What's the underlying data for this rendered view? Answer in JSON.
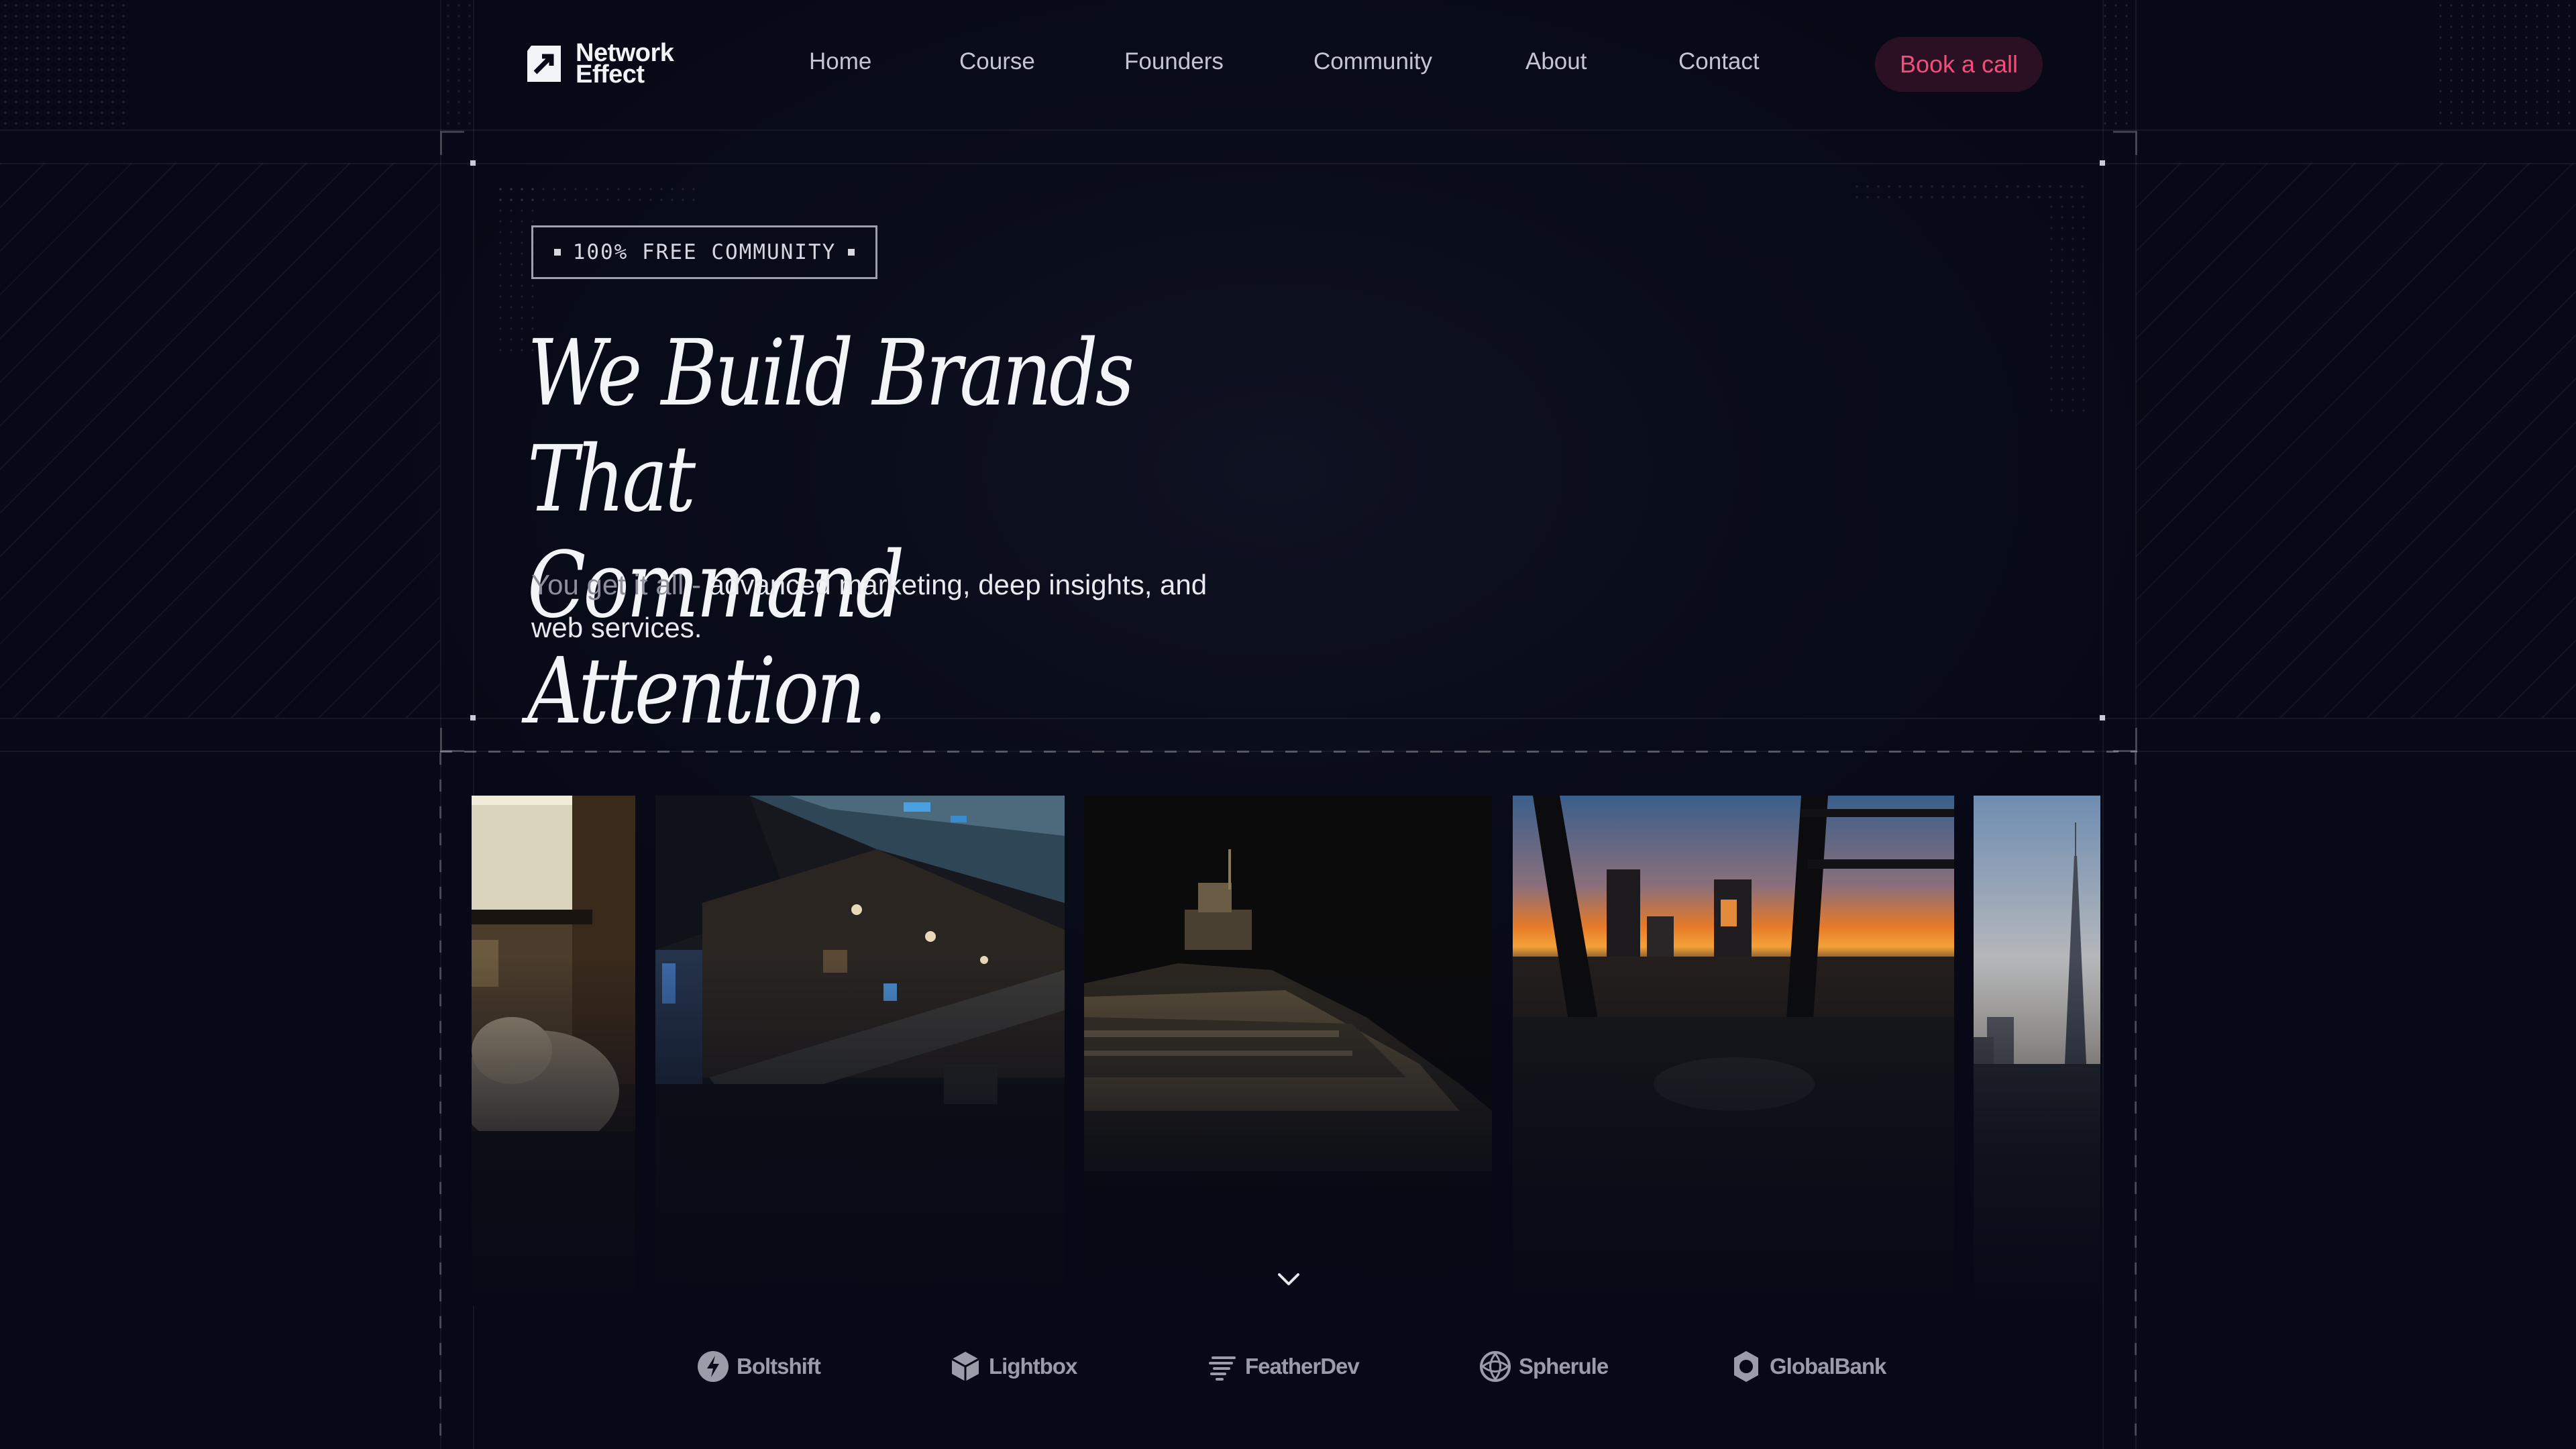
{
  "brand": {
    "name_line1": "Network",
    "name_line2": "Effect"
  },
  "nav": {
    "links": [
      "Home",
      "Course",
      "Founders",
      "Community",
      "About",
      "Contact"
    ],
    "cta": "Book a call"
  },
  "hero": {
    "badge": "100% FREE COMMUNITY",
    "headline_line1": "We Build Brands That",
    "headline_line2": "Command Attention.",
    "subtext_muted": "You get it all - ",
    "subtext_main": "advanced marketing, deep insights, and web services."
  },
  "gallery": {
    "images": [
      "lobby-interior",
      "staircase-glass-ceiling",
      "yacht-night",
      "city-sunset-window",
      "burj-khalifa-skyline"
    ]
  },
  "logos": [
    "Boltshift",
    "Lightbox",
    "FeatherDev",
    "Spherule",
    "GlobalBank"
  ],
  "colors": {
    "accent": "#ef4f7a",
    "cta_bg": "#2a1022",
    "background": "#070a16"
  },
  "icons": {
    "scroll": "chevron-down-icon"
  }
}
